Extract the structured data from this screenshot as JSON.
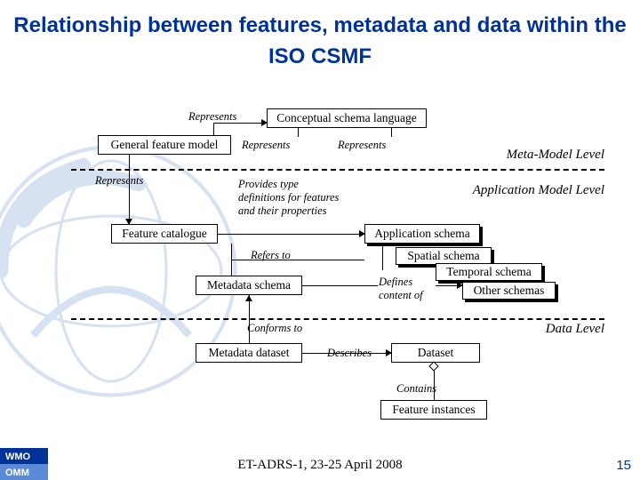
{
  "title": "Relationship between features, metadata and data within the ISO CSMF",
  "footer": "ET-ADRS-1, 23-25 April 2008",
  "page_number": "15",
  "levels": {
    "meta": "Meta-Model Level",
    "app": "Application Model Level",
    "data": "Data Level"
  },
  "labels": {
    "represents": "Represents",
    "provides": "Provides type definitions for features and their properties",
    "refers_to": "Refers to",
    "conforms_to": "Conforms to",
    "describes": "Describes",
    "defines_content": "Defines content of",
    "contains": "Contains"
  },
  "boxes": {
    "csl": "Conceptual schema language",
    "gfm": "General feature model",
    "fc": "Feature catalogue",
    "ms": "Metadata schema",
    "md": "Metadata dataset",
    "as": "Application schema",
    "ss": "Spatial schema",
    "ts": "Temporal schema",
    "os": "Other schemas",
    "ds": "Dataset",
    "fi": "Feature instances"
  }
}
